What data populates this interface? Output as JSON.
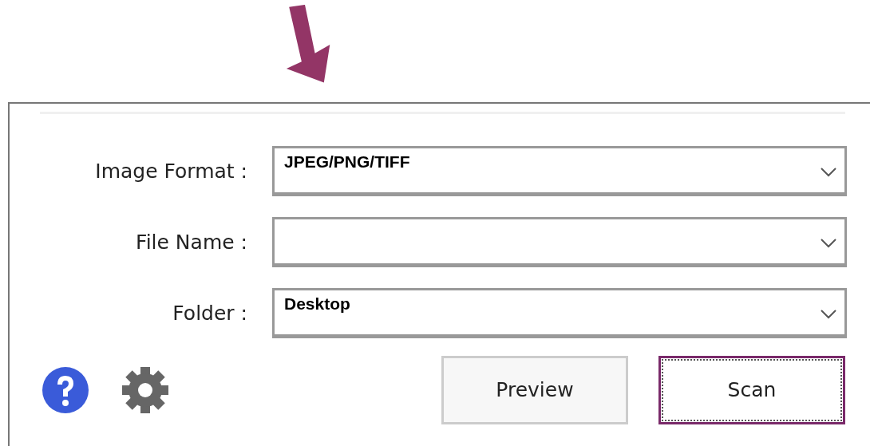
{
  "fields": [
    {
      "label": "Image Format :",
      "value": "JPEG/PNG/TIFF"
    },
    {
      "label": "File Name :"
    },
    {
      "label": "Folder :",
      "value": "Desktop"
    }
  ],
  "buttons": [
    {
      "label": "Preview",
      "focused": false
    },
    {
      "label": "Scan",
      "focused": true
    }
  ]
}
